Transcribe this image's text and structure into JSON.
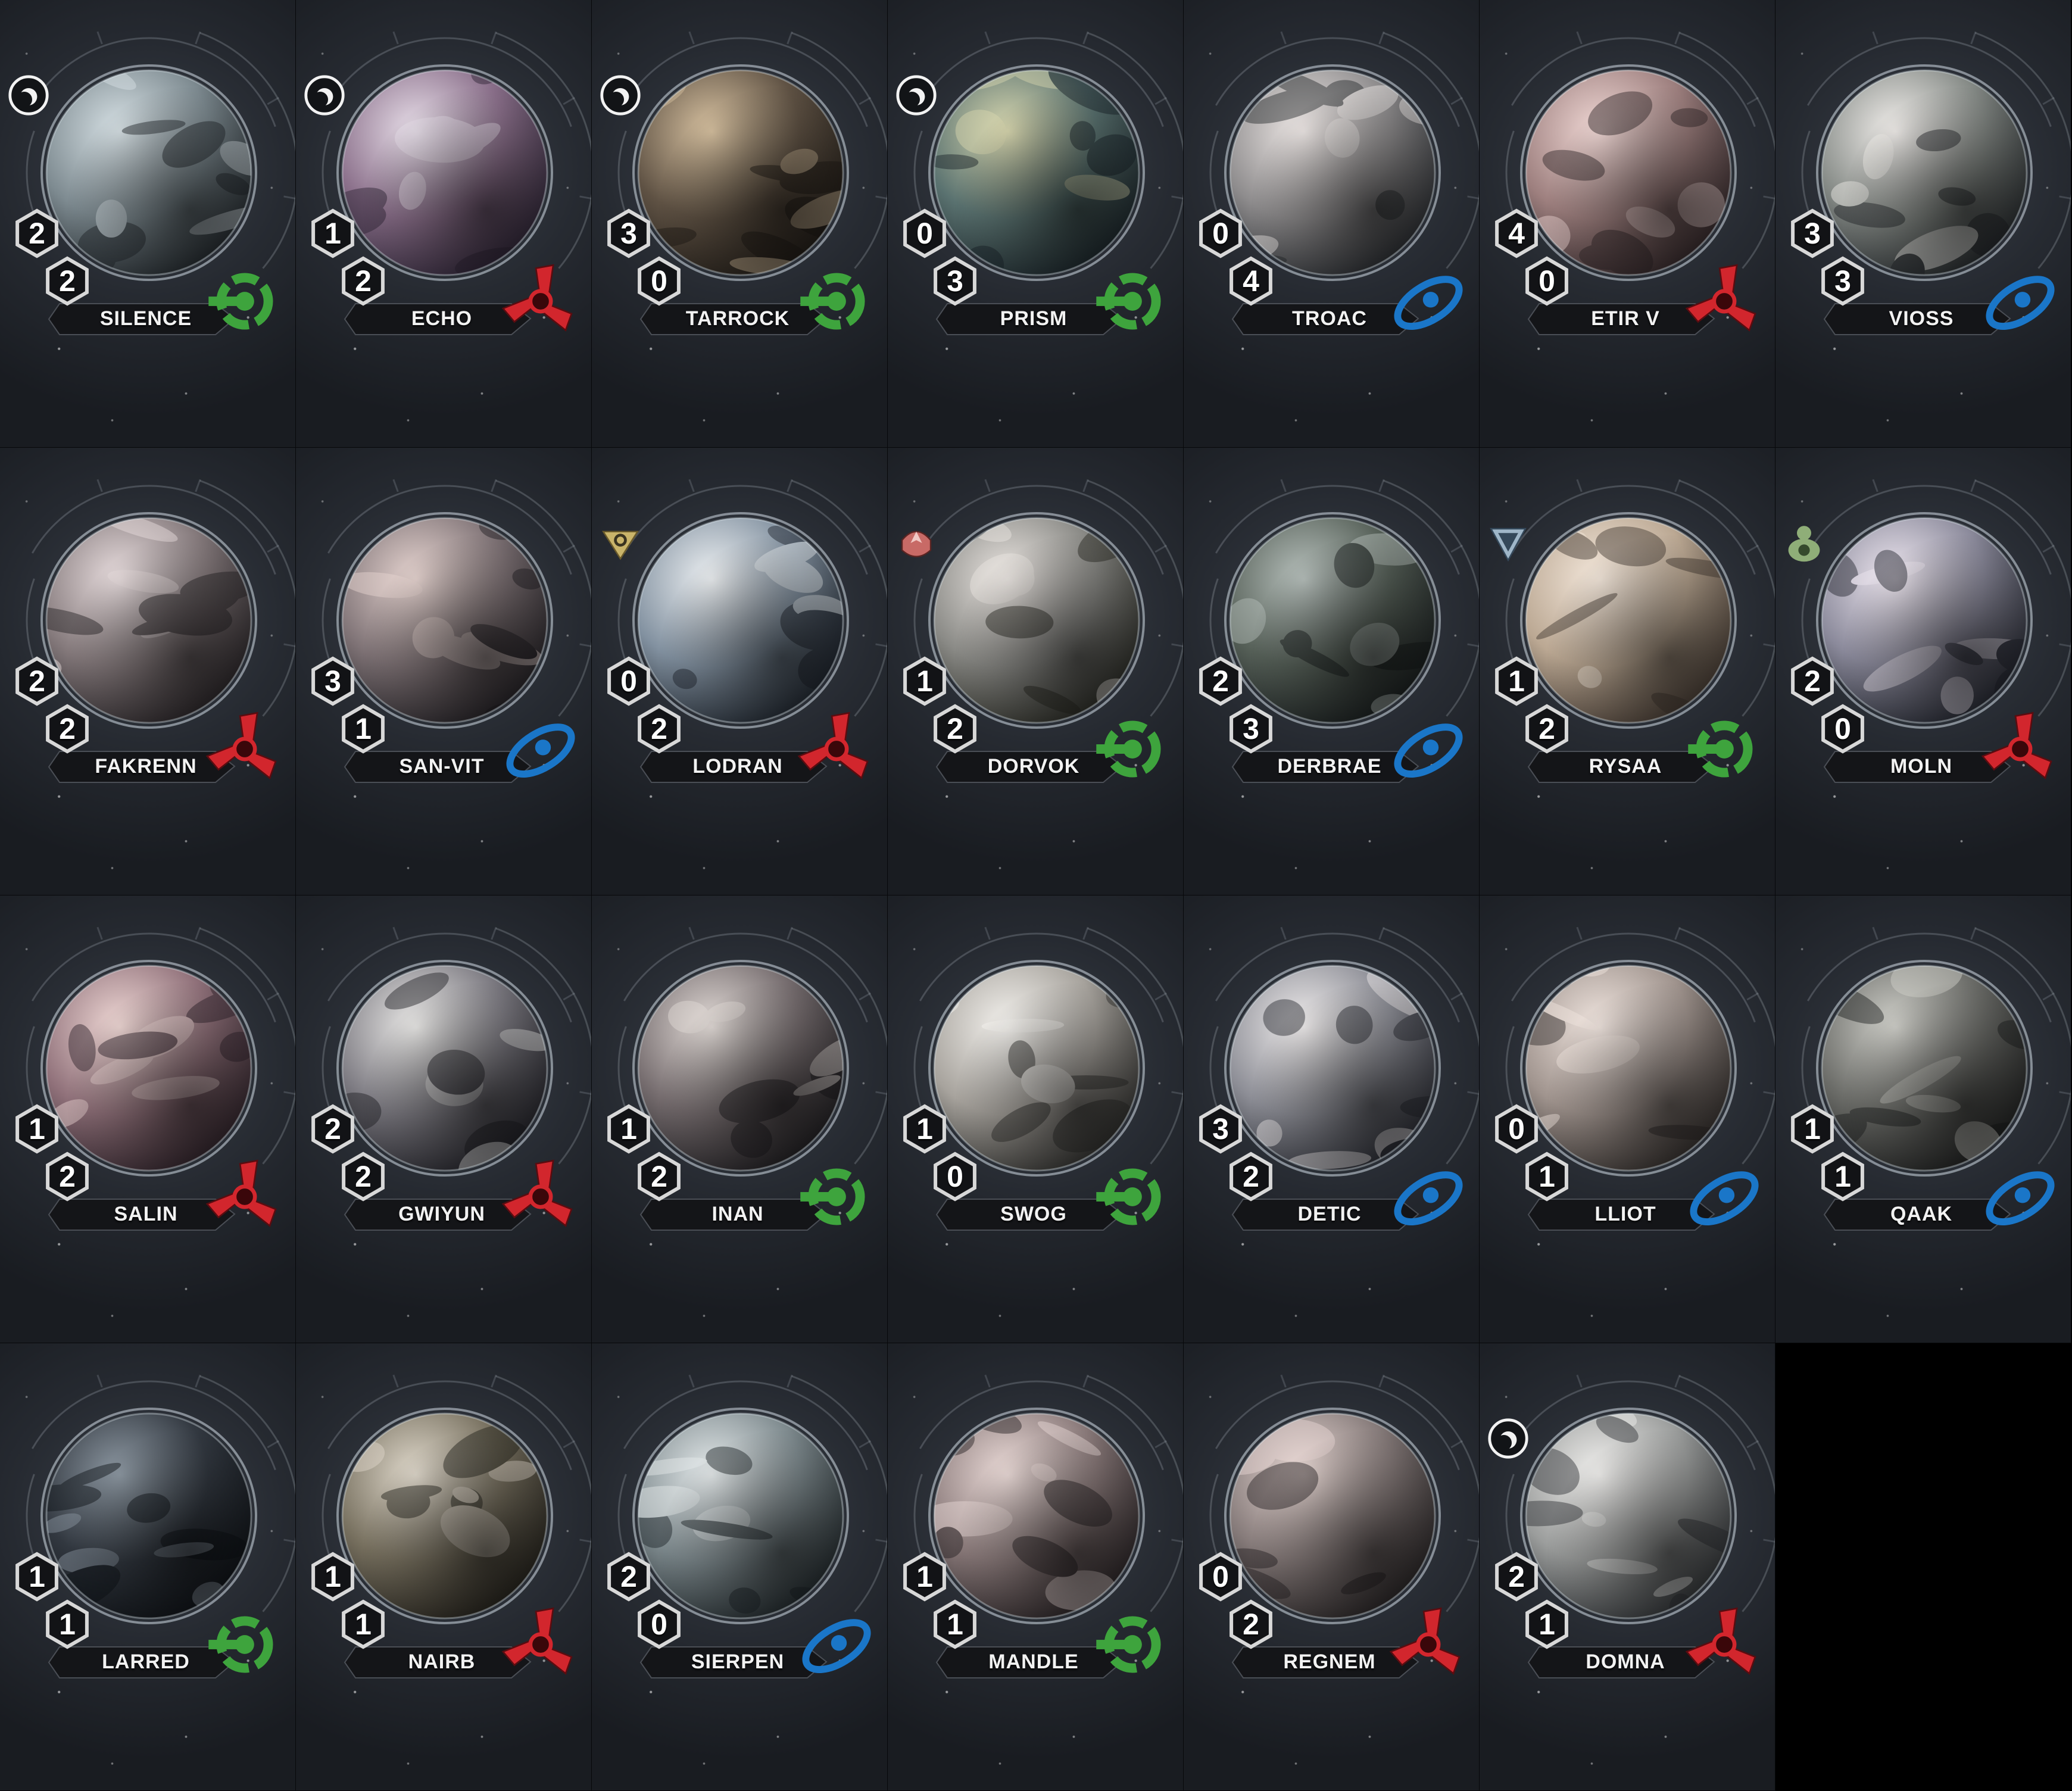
{
  "colors": {
    "hazardous": "#d2262d",
    "industrial": "#3ea43d",
    "cultural": "#1a76c8",
    "card_background": "#22262c"
  },
  "planets": [
    {
      "name": "SILENCE",
      "resources": "2",
      "influence": "2",
      "trait": "industrial",
      "legendary": false,
      "specialty": "legend-circle",
      "hues": [
        "#d8e2e6",
        "#7d8a90",
        "#1d2226"
      ]
    },
    {
      "name": "ECHO",
      "resources": "1",
      "influence": "2",
      "trait": "hazardous",
      "legendary": false,
      "specialty": "legend-circle",
      "hues": [
        "#e9e0ea",
        "#8a6f8a",
        "#2a2232"
      ]
    },
    {
      "name": "TARROCK",
      "resources": "3",
      "influence": "0",
      "trait": "industrial",
      "legendary": false,
      "specialty": "legend-circle",
      "hues": [
        "#d9c3a2",
        "#5f5244",
        "#1d1915"
      ]
    },
    {
      "name": "PRISM",
      "resources": "0",
      "influence": "3",
      "trait": "industrial",
      "legendary": false,
      "specialty": "legend-circle",
      "hues": [
        "#d9d8b0",
        "#5a7270",
        "#182126"
      ]
    },
    {
      "name": "TROAC",
      "resources": "0",
      "influence": "4",
      "trait": "cultural",
      "legendary": false,
      "specialty": "",
      "hues": [
        "#f0eae8",
        "#8e8c8d",
        "#23262a"
      ]
    },
    {
      "name": "ETIR V",
      "resources": "4",
      "influence": "0",
      "trait": "hazardous",
      "legendary": false,
      "specialty": "",
      "hues": [
        "#f1d9d6",
        "#9d7f7e",
        "#2c2224"
      ]
    },
    {
      "name": "VIOSS",
      "resources": "3",
      "influence": "3",
      "trait": "cultural",
      "legendary": false,
      "specialty": "",
      "hues": [
        "#f2efec",
        "#858a86",
        "#1f2326"
      ]
    },
    {
      "name": "FAKRENN",
      "resources": "2",
      "influence": "2",
      "trait": "hazardous",
      "legendary": false,
      "specialty": "",
      "hues": [
        "#eadfe0",
        "#857a7c",
        "#231f22"
      ]
    },
    {
      "name": "SAN-VIT",
      "resources": "3",
      "influence": "1",
      "trait": "cultural",
      "legendary": false,
      "specialty": "",
      "hues": [
        "#e8d6d2",
        "#7f7376",
        "#1e1c20"
      ]
    },
    {
      "name": "LODRAN",
      "resources": "0",
      "influence": "2",
      "trait": "hazardous",
      "legendary": false,
      "specialty": "tech-yellow",
      "hues": [
        "#eef1f3",
        "#8291a0",
        "#1b2129"
      ]
    },
    {
      "name": "DORVOK",
      "resources": "1",
      "influence": "2",
      "trait": "industrial",
      "legendary": false,
      "specialty": "tech-red",
      "hues": [
        "#ebe6e2",
        "#8a8a86",
        "#24251f"
      ]
    },
    {
      "name": "DERBRAE",
      "resources": "2",
      "influence": "3",
      "trait": "cultural",
      "legendary": false,
      "specialty": "",
      "hues": [
        "#b8c1bd",
        "#566058",
        "#15191a"
      ]
    },
    {
      "name": "RYSAA",
      "resources": "1",
      "influence": "2",
      "trait": "industrial",
      "legendary": false,
      "specialty": "tech-blue",
      "hues": [
        "#f4e8dc",
        "#bba893",
        "#3e342d"
      ]
    },
    {
      "name": "MOLN",
      "resources": "2",
      "influence": "0",
      "trait": "hazardous",
      "legendary": false,
      "specialty": "tech-green",
      "hues": [
        "#f0e9f2",
        "#8b8a9b",
        "#1e2129"
      ]
    },
    {
      "name": "SALIN",
      "resources": "1",
      "influence": "2",
      "trait": "hazardous",
      "legendary": false,
      "specialty": "",
      "hues": [
        "#f0d9d6",
        "#90717a",
        "#2a1f26"
      ]
    },
    {
      "name": "GWIYUN",
      "resources": "2",
      "influence": "2",
      "trait": "hazardous",
      "legendary": false,
      "specialty": "",
      "hues": [
        "#ebeae8",
        "#7d7b82",
        "#1d1d23"
      ]
    },
    {
      "name": "INAN",
      "resources": "1",
      "influence": "2",
      "trait": "industrial",
      "legendary": false,
      "specialty": "",
      "hues": [
        "#e3dcd8",
        "#756c6e",
        "#1b1a1d"
      ]
    },
    {
      "name": "SWOG",
      "resources": "1",
      "influence": "0",
      "trait": "industrial",
      "legendary": false,
      "specialty": "",
      "hues": [
        "#f5f3ef",
        "#a7a39d",
        "#2a2a28"
      ]
    },
    {
      "name": "DETIC",
      "resources": "3",
      "influence": "2",
      "trait": "cultural",
      "legendary": false,
      "specialty": "",
      "hues": [
        "#f1eeee",
        "#8d8e96",
        "#23252c"
      ]
    },
    {
      "name": "LLIOT",
      "resources": "0",
      "influence": "1",
      "trait": "cultural",
      "legendary": false,
      "specialty": "",
      "hues": [
        "#f1e6e0",
        "#a0948e",
        "#2c2826"
      ]
    },
    {
      "name": "QAAK",
      "resources": "1",
      "influence": "1",
      "trait": "cultural",
      "legendary": false,
      "specialty": "",
      "hues": [
        "#d2d2cc",
        "#6b6c68",
        "#1a1b1b"
      ]
    },
    {
      "name": "LARRED",
      "resources": "1",
      "influence": "1",
      "trait": "industrial",
      "legendary": false,
      "specialty": "",
      "hues": [
        "#8f9aa4",
        "#323840",
        "#0d1014"
      ]
    },
    {
      "name": "NAIRB",
      "resources": "1",
      "influence": "1",
      "trait": "hazardous",
      "legendary": false,
      "specialty": "",
      "hues": [
        "#e1dacd",
        "#77705f",
        "#1f1d18"
      ]
    },
    {
      "name": "SIERPEN",
      "resources": "2",
      "influence": "0",
      "trait": "cultural",
      "legendary": false,
      "specialty": "",
      "hues": [
        "#e6ebec",
        "#7e8a8e",
        "#1c2326"
      ]
    },
    {
      "name": "MANDLE",
      "resources": "1",
      "influence": "1",
      "trait": "industrial",
      "legendary": false,
      "specialty": "",
      "hues": [
        "#ecdcd9",
        "#8b7b7b",
        "#231e20"
      ]
    },
    {
      "name": "REGNEM",
      "resources": "0",
      "influence": "2",
      "trait": "hazardous",
      "legendary": false,
      "specialty": "",
      "hues": [
        "#eadad6",
        "#857a79",
        "#221f20"
      ]
    },
    {
      "name": "DOMNA",
      "resources": "2",
      "influence": "1",
      "trait": "hazardous",
      "legendary": true,
      "specialty": "legend-circle",
      "hues": [
        "#f2f1ef",
        "#9b9d9c",
        "#2b2e31"
      ]
    }
  ]
}
